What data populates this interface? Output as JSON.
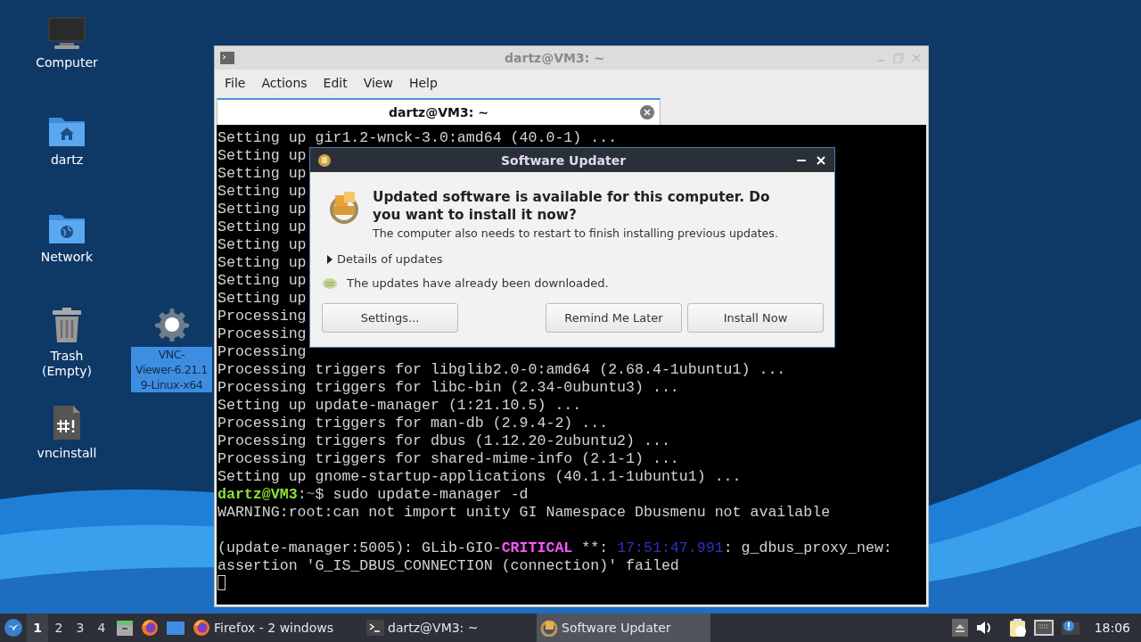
{
  "desktop_icons": [
    {
      "kind": "computer",
      "lines": [
        "Computer"
      ],
      "selected": false
    },
    {
      "kind": "home",
      "lines": [
        "dartz"
      ],
      "selected": false
    },
    {
      "kind": "network",
      "lines": [
        "Network"
      ],
      "selected": false
    },
    {
      "kind": "trash",
      "lines": [
        "Trash (Empty)"
      ],
      "selected": false
    },
    {
      "kind": "script",
      "lines": [
        "vncinstall"
      ],
      "selected": false
    },
    {
      "kind": "gear",
      "lines": [
        "VNC-",
        "Viewer-6.21.1",
        "9-Linux-x64"
      ],
      "selected": true
    }
  ],
  "terminal": {
    "title": "dartz@VM3: ~",
    "menu": [
      "File",
      "Actions",
      "Edit",
      "View",
      "Help"
    ],
    "tabs": [
      {
        "label": "dartz@VM3: ~",
        "selected": true
      }
    ],
    "lines": [
      [
        {
          "text": "Setting up gir1.2-wnck-3.0:amd64 (40.0-1) ...",
          "kind": "plain"
        }
      ],
      [
        {
          "text": "Setting up",
          "kind": "plain"
        }
      ],
      [
        {
          "text": "Setting up",
          "kind": "plain"
        }
      ],
      [
        {
          "text": "Setting up",
          "kind": "plain"
        }
      ],
      [
        {
          "text": "Setting up",
          "kind": "plain"
        }
      ],
      [
        {
          "text": "Setting up",
          "kind": "plain"
        }
      ],
      [
        {
          "text": "Setting up",
          "kind": "plain"
        }
      ],
      [
        {
          "text": "Setting up",
          "kind": "plain"
        }
      ],
      [
        {
          "text": "Setting up",
          "kind": "plain"
        }
      ],
      [
        {
          "text": "Setting up",
          "kind": "plain"
        }
      ],
      [
        {
          "text": "Processing",
          "kind": "plain"
        }
      ],
      [
        {
          "text": "Processing",
          "kind": "plain"
        }
      ],
      [
        {
          "text": "Processing",
          "kind": "plain"
        }
      ],
      [
        {
          "text": "Processing triggers for libglib2.0-0:amd64 (2.68.4-1ubuntu1) ...",
          "kind": "plain"
        }
      ],
      [
        {
          "text": "Processing triggers for libc-bin (2.34-0ubuntu3) ...",
          "kind": "plain"
        }
      ],
      [
        {
          "text": "Setting up update-manager (1:21.10.5) ...",
          "kind": "plain"
        }
      ],
      [
        {
          "text": "Processing triggers for man-db (2.9.4-2) ...",
          "kind": "plain"
        }
      ],
      [
        {
          "text": "Processing triggers for dbus (1.12.20-2ubuntu2) ...",
          "kind": "plain"
        }
      ],
      [
        {
          "text": "Processing triggers for shared-mime-info (2.1-1) ...",
          "kind": "plain"
        }
      ],
      [
        {
          "text": "Setting up gnome-startup-applications (40.1.1-1ubuntu1) ...",
          "kind": "plain"
        }
      ],
      [
        {
          "text": "dartz@VM3",
          "kind": "user"
        },
        {
          "text": ":",
          "kind": "plain"
        },
        {
          "text": "~",
          "kind": "path"
        },
        {
          "text": "$ sudo update-manager -d",
          "kind": "plain"
        }
      ],
      [
        {
          "text": "WARNING:root:can not import unity GI Namespace Dbusmenu not available",
          "kind": "plain"
        }
      ],
      [
        {
          "kind": "blank"
        }
      ],
      [
        {
          "text": "(update-manager:5005): GLib-GIO-",
          "kind": "plain"
        },
        {
          "text": "CRITICAL",
          "kind": "critical"
        },
        {
          "text": " **: ",
          "kind": "plain"
        },
        {
          "text": "17:51:47.991",
          "kind": "timestamp"
        },
        {
          "text": ": g_dbus_proxy_new:",
          "kind": "plain"
        }
      ],
      [
        {
          "text": "assertion 'G_IS_DBUS_CONNECTION (connection)' failed",
          "kind": "plain"
        }
      ]
    ]
  },
  "dialog": {
    "title": "Software Updater",
    "heading": "Updated software is available for this computer. Do you want to install it now?",
    "message": "The computer also needs to restart to finish installing previous updates.",
    "details": {
      "label": "Details of updates",
      "expanded": false
    },
    "status": "The updates have already been downloaded.",
    "buttons": [
      {
        "label": "Settings..."
      },
      {
        "label": "Remind Me Later"
      },
      {
        "label": "Install Now"
      }
    ]
  },
  "taskbar": {
    "workspaces": [
      {
        "label": "1",
        "selected": true
      },
      {
        "label": "2",
        "selected": false
      },
      {
        "label": "3",
        "selected": false
      },
      {
        "label": "4",
        "selected": false
      }
    ],
    "tasks": [
      {
        "label": "Firefox - 2 windows",
        "kind": "firefox",
        "selected": false
      },
      {
        "label": "dartz@VM3: ~",
        "kind": "terminal",
        "selected": false
      },
      {
        "label": "Software Updater",
        "kind": "updater",
        "selected": true
      }
    ],
    "clock": "18:06"
  }
}
